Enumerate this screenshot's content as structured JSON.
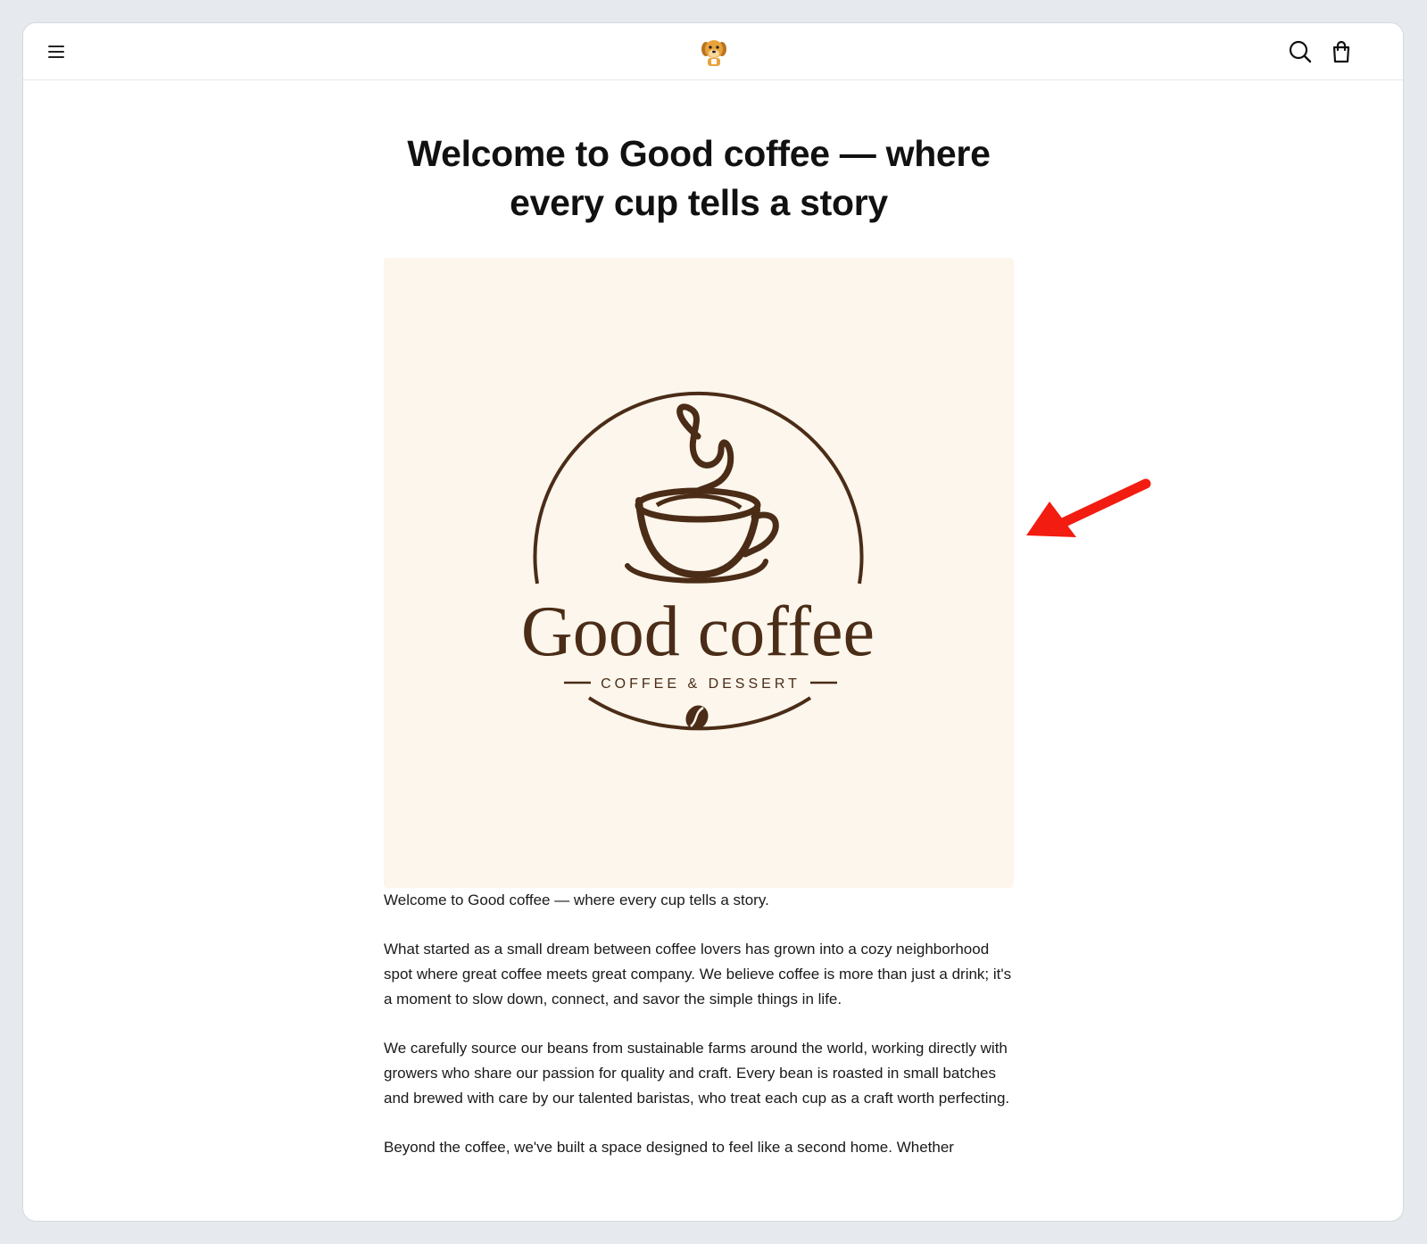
{
  "header": {
    "menu_icon": "hamburger-menu-icon",
    "logo_icon": "dog-mascot-logo",
    "search_icon": "search-icon",
    "cart_icon": "shopping-bag-icon"
  },
  "page": {
    "title": "Welcome to Good coffee — where every cup tells a story"
  },
  "hero": {
    "brand_name": "Good coffee",
    "tagline": "COFFEE & DESSERT",
    "background_color": "#fcf6ec",
    "brand_color": "#4a2c17"
  },
  "body": {
    "paragraphs": [
      "Welcome to Good coffee — where every cup tells a story.",
      "What started as a small dream between coffee lovers has grown into a cozy neighborhood spot where great coffee meets great company. We believe coffee is more than just a drink; it's a moment to slow down, connect, and savor the simple things in life.",
      "We carefully source our beans from sustainable farms around the world, working directly with growers who share our passion for quality and craft. Every bean is roasted in small batches and brewed with care by our talented baristas, who treat each cup as a craft worth perfecting.",
      "Beyond the coffee, we've built a space designed to feel like a second home. Whether"
    ]
  },
  "annotation": {
    "arrow_color": "#f21c10"
  }
}
